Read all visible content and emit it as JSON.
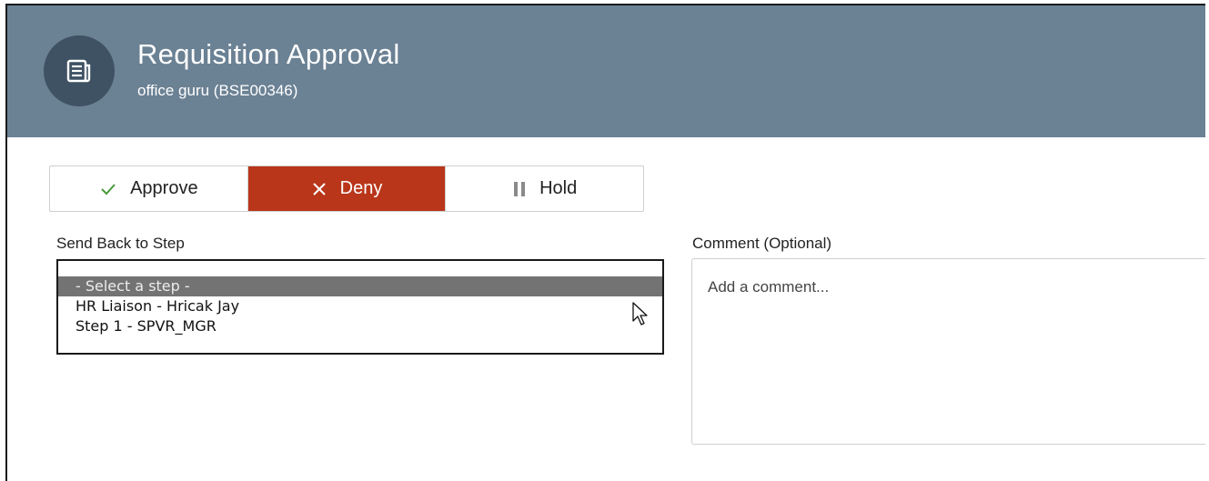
{
  "header": {
    "title": "Requisition Approval",
    "subtitle": "office guru (BSE00346)",
    "icon": "document-list-icon"
  },
  "actions": {
    "approve_label": "Approve",
    "deny_label": "Deny",
    "hold_label": "Hold",
    "selected": "Deny",
    "approve_icon": "check-icon",
    "deny_icon": "close-icon",
    "hold_icon": "pause-icon",
    "accent_color": "#b9361a"
  },
  "send_back": {
    "label": "Send Back to Step",
    "options": [
      "- Select a step -",
      "HR Liaison - Hricak Jay",
      "Step 1 - SPVR_MGR"
    ],
    "highlighted_index": 0
  },
  "comment": {
    "label": "Comment (Optional)",
    "placeholder": "Add a comment...",
    "value": ""
  },
  "colors": {
    "header_bg": "#6b8194",
    "icon_circle": "#3e5264",
    "highlight_option": "#737373"
  }
}
